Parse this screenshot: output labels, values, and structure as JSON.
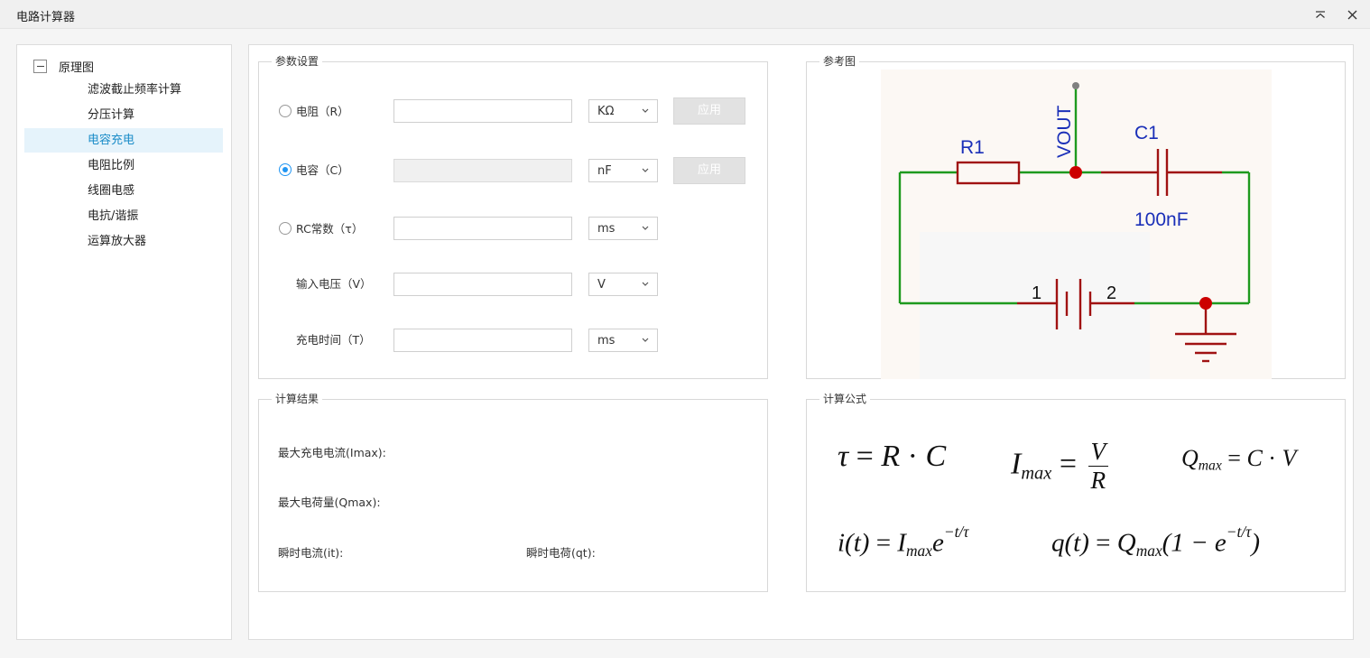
{
  "window": {
    "title": "电路计算器"
  },
  "tree": {
    "root_label": "原理图",
    "items": [
      {
        "label": "滤波截止频率计算",
        "selected": false
      },
      {
        "label": "分压计算",
        "selected": false
      },
      {
        "label": "电容充电",
        "selected": true
      },
      {
        "label": "电阻比例",
        "selected": false
      },
      {
        "label": "线圈电感",
        "selected": false
      },
      {
        "label": "电抗/谐振",
        "selected": false
      },
      {
        "label": "运算放大器",
        "selected": false
      }
    ]
  },
  "params": {
    "title": "参数设置",
    "rows": [
      {
        "label": "电阻（R）",
        "radio": true,
        "checked": false,
        "value": "",
        "unit": "KΩ",
        "apply": "应用",
        "disabled": false
      },
      {
        "label": "电容（C）",
        "radio": true,
        "checked": true,
        "value": "",
        "unit": "nF",
        "apply": "应用",
        "disabled": true
      },
      {
        "label": "RC常数（τ）",
        "radio": true,
        "checked": false,
        "value": "",
        "unit": "ms"
      },
      {
        "label": "输入电压（V）",
        "radio": false,
        "value": "",
        "unit": "V"
      },
      {
        "label": "充电时间（T）",
        "radio": false,
        "value": "",
        "unit": "ms"
      }
    ]
  },
  "reference": {
    "title": "参考图",
    "schematic": {
      "vout_label": "VOUT",
      "resistor_label": "R1",
      "capacitor_label": "C1",
      "capacitor_value": "100nF",
      "battery_pin1": "1",
      "battery_pin2": "2",
      "colors": {
        "wire": "#1e9a1e",
        "component": "#a01212",
        "node": "#cc0000",
        "label": "#1a2fb8",
        "pin": "#808080"
      }
    }
  },
  "results": {
    "title": "计算结果",
    "max_current": "最大充电电流(Imax):",
    "max_charge": "最大电荷量(Qmax):",
    "instant_current": "瞬时电流(it):",
    "instant_charge": "瞬时电荷(qt):"
  },
  "formulas": {
    "title": "计算公式",
    "f1": {
      "lhs": "τ",
      "eq": "=",
      "r": "R",
      "dot": "·",
      "c": "C"
    },
    "f2": {
      "i": "I",
      "sub": "max",
      "eq": "=",
      "num": "V",
      "den": "R"
    },
    "f3": {
      "q": "Q",
      "sub": "max",
      "eq": "=",
      "c": "C",
      "dot": "·",
      "v": "V"
    },
    "f4": {
      "lhs": "i(t)",
      "eq": "=",
      "i": "I",
      "sub": "max",
      "e": "e",
      "exp": "−t/τ"
    },
    "f5": {
      "lhs": "q(t)",
      "eq": "=",
      "q": "Q",
      "sub": "max",
      "open": "(1 −",
      "e": "e",
      "exp": "−t/τ",
      "close": ")"
    }
  }
}
